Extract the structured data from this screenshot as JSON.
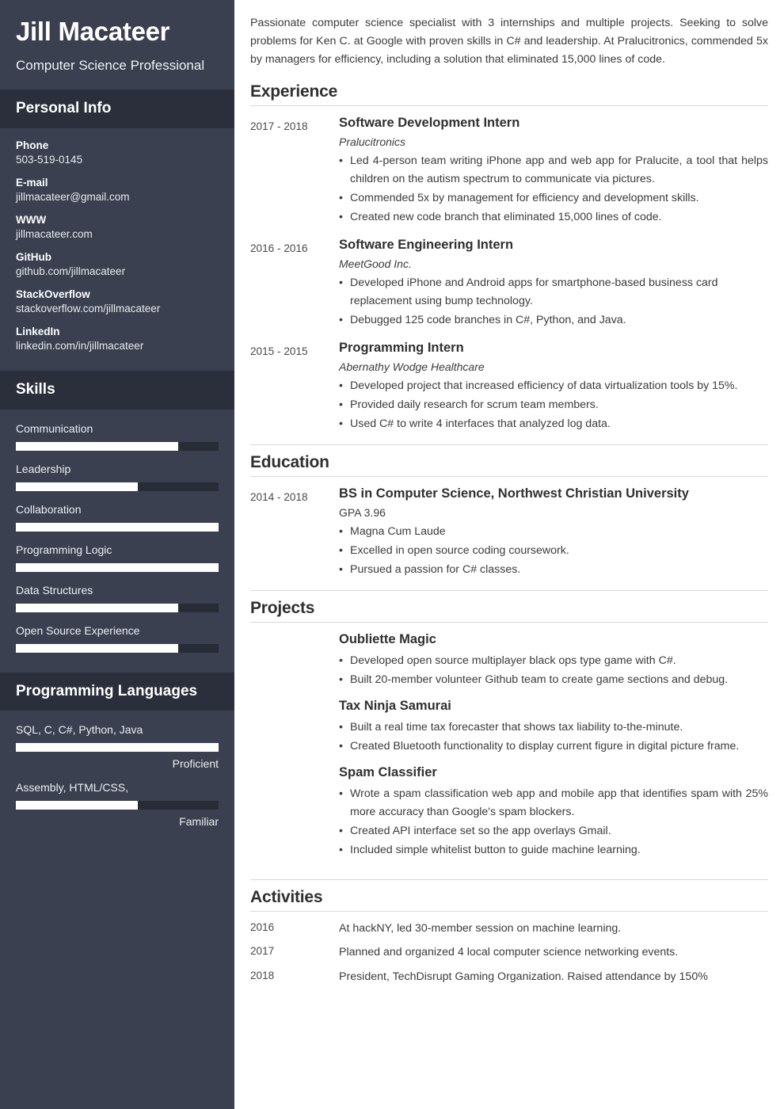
{
  "sidebar": {
    "name": "Jill Macateer",
    "role": "Computer Science Professional",
    "personal_info": {
      "heading": "Personal Info",
      "items": [
        {
          "label": "Phone",
          "value": "503-519-0145"
        },
        {
          "label": "E-mail",
          "value": "jillmacateer@gmail.com"
        },
        {
          "label": "WWW",
          "value": "jillmacateer.com"
        },
        {
          "label": "GitHub",
          "value": "github.com/jillmacateer"
        },
        {
          "label": "StackOverflow",
          "value": "stackoverflow.com/jillmacateer"
        },
        {
          "label": "LinkedIn",
          "value": "linkedin.com/in/jillmacateer"
        }
      ]
    },
    "skills": {
      "heading": "Skills",
      "items": [
        {
          "name": "Communication",
          "level": 80
        },
        {
          "name": "Leadership",
          "level": 60
        },
        {
          "name": "Collaboration",
          "level": 100
        },
        {
          "name": "Programming Logic",
          "level": 100
        },
        {
          "name": "Data Structures",
          "level": 80
        },
        {
          "name": "Open Source Experience",
          "level": 80
        }
      ]
    },
    "languages": {
      "heading": "Programming Languages",
      "items": [
        {
          "name": "SQL, C, C#,  Python, Java",
          "level": 100,
          "rating": "Proficient"
        },
        {
          "name": "Assembly, HTML/CSS,",
          "level": 60,
          "rating": "Familiar"
        }
      ]
    }
  },
  "main": {
    "summary": "Passionate computer science specialist with 3 internships and multiple projects. Seeking to solve problems for Ken C. at Google with proven skills in C# and leadership. At Pralucitronics, commended 5x by managers for efficiency, including a solution that eliminated 15,000 lines of code.",
    "experience": {
      "heading": "Experience",
      "entries": [
        {
          "date": "2017 - 2018",
          "title": "Software Development Intern",
          "company": "Pralucitronics",
          "bullets": [
            "Led 4-person team writing iPhone app and web app for Pralucite, a tool that helps children on the autism spectrum to communicate via pictures.",
            "Commended 5x by management for efficiency and development skills.",
            "Created new code branch that eliminated 15,000 lines of code."
          ]
        },
        {
          "date": "2016 - 2016",
          "title": "Software Engineering Intern",
          "company": "MeetGood Inc.",
          "bullets": [
            "Developed iPhone and Android apps for smartphone-based business card replacement using bump technology.",
            "Debugged 125 code branches in C#, Python, and Java."
          ]
        },
        {
          "date": "2015 - 2015",
          "title": "Programming Intern",
          "company": "Abernathy Wodge Healthcare",
          "bullets": [
            "Developed project that increased efficiency of data virtualization tools by 15%.",
            "Provided daily research for scrum team members.",
            "Used C# to write 4 interfaces that analyzed log data."
          ]
        }
      ]
    },
    "education": {
      "heading": "Education",
      "entries": [
        {
          "date": "2014 - 2018",
          "title": "BS in Computer Science, Northwest Christian University",
          "subtitle": "GPA 3.96",
          "bullets": [
            "Magna Cum Laude",
            "Excelled in open source coding coursework.",
            "Pursued a passion for C# classes."
          ]
        }
      ]
    },
    "projects": {
      "heading": "Projects",
      "entries": [
        {
          "title": "Oubliette Magic",
          "bullets": [
            "Developed open source multiplayer black ops type game with C#.",
            "Built 20-member volunteer Github team to create game sections and debug."
          ]
        },
        {
          "title": "Tax Ninja Samurai",
          "bullets": [
            "Built a real time tax forecaster that shows tax liability to-the-minute.",
            "Created Bluetooth functionality to display current figure in digital picture frame."
          ]
        },
        {
          "title": "Spam Classifier",
          "bullets": [
            "Wrote a spam classification web app and mobile app that identifies spam with 25% more accuracy than Google's spam blockers.",
            "Created API interface set so the app overlays Gmail.",
            "Included simple whitelist button to guide machine learning."
          ]
        }
      ]
    },
    "activities": {
      "heading": "Activities",
      "rows": [
        {
          "year": "2016",
          "text": "At hackNY, led 30-member session on machine learning."
        },
        {
          "year": "2017",
          "text": "Planned and organized 4 local computer science networking events."
        },
        {
          "year": "2018",
          "text": "President, TechDisrupt Gaming Organization. Raised attendance by 150%"
        }
      ]
    }
  },
  "colors": {
    "sidebar_bg": "#3a4050",
    "sidebar_band": "#2a2f3b",
    "bar_track": "#272c36",
    "bar_fill": "#ffffff",
    "text_dark": "#333333",
    "rule": "#d8d8d8"
  }
}
